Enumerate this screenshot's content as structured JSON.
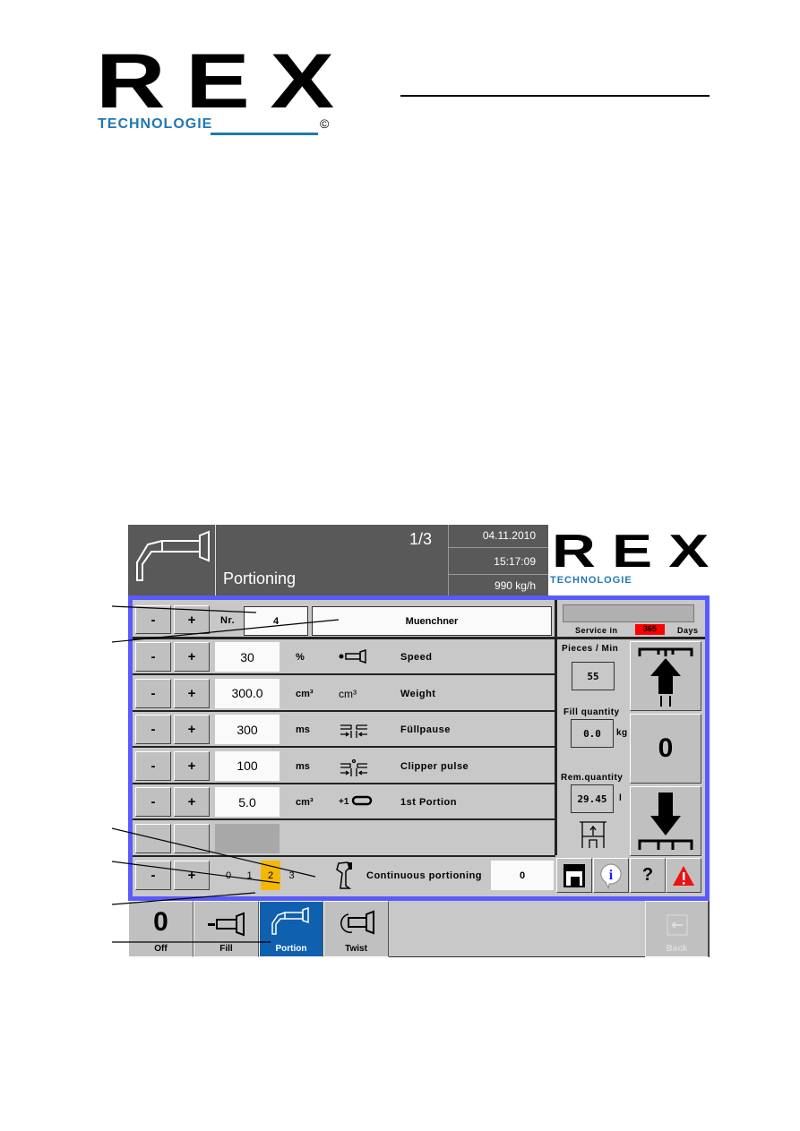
{
  "page_logo": {
    "brand": "REX",
    "sub": "TECHNOLOGIE",
    "mark": "©"
  },
  "header": {
    "title": "Portioning",
    "page": "1/3",
    "date": "04.11.2010",
    "time": "15:17:09",
    "rate": "990 kg/h"
  },
  "program": {
    "minus": "-",
    "plus": "+",
    "nr_label": "Nr.",
    "nr_value": "4",
    "name": "Muenchner"
  },
  "params": [
    {
      "value": "30",
      "unit": "%",
      "label": "Speed",
      "icon": "speed-icon"
    },
    {
      "value": "300.0",
      "unit": "cm³",
      "label": "Weight",
      "icon": "volume-icon",
      "icon_text": "cm³"
    },
    {
      "value": "300",
      "unit": "ms",
      "label": "Füllpause",
      "icon": "fill-pause-icon"
    },
    {
      "value": "100",
      "unit": "ms",
      "label": "Clipper pulse",
      "icon": "clipper-pulse-icon"
    },
    {
      "value": "5.0",
      "unit": "cm³",
      "label": "1st Portion",
      "icon": "first-portion-icon",
      "icon_text": "+1"
    }
  ],
  "continuous": {
    "levels": [
      "0",
      "1",
      "2",
      "3"
    ],
    "selected": "2",
    "label": "Continuous portioning",
    "value": "0"
  },
  "service": {
    "label": "Service in",
    "days": "365",
    "unit": "Days"
  },
  "stats": {
    "pieces_label": "Pieces / Min",
    "pieces": "55",
    "fill_label": "Fill quantity",
    "fill": "0.0",
    "fill_unit": "kg",
    "rem_label": "Rem.quantity",
    "rem": "29.45",
    "rem_unit": "l"
  },
  "counter_value": "0",
  "help": "?",
  "nav": [
    {
      "label": "Off",
      "glyph": "0"
    },
    {
      "label": "Fill"
    },
    {
      "label": "Portion",
      "active": true
    },
    {
      "label": "Twist"
    }
  ],
  "back": "Back",
  "colors": {
    "frame": "#5a5aff",
    "active_tab": "#1060b0",
    "selected_level": "#f5b800",
    "service_badge": "#ff0000"
  }
}
